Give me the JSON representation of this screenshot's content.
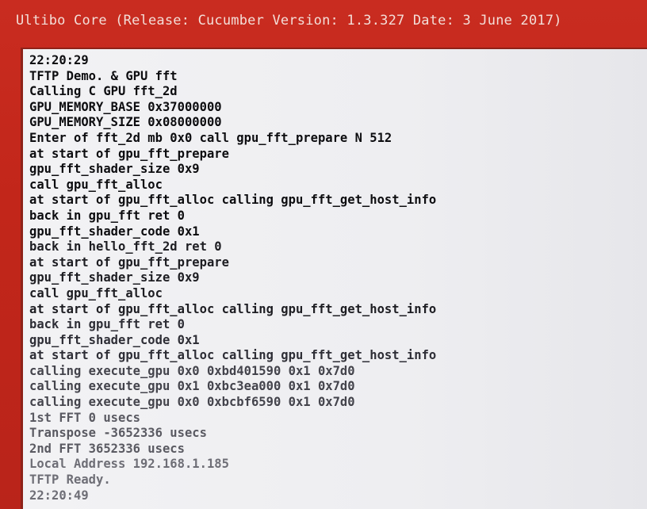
{
  "title_bar": {
    "text": "Ultibo Core (Release: Cucumber Version: 1.3.327 Date: 3 June 2017)"
  },
  "console": {
    "lines": [
      "22:20:29",
      "TFTP Demo. & GPU fft",
      "Calling C GPU fft_2d",
      "GPU_MEMORY_BASE 0x37000000",
      "GPU_MEMORY_SIZE 0x08000000",
      "Enter of fft_2d mb 0x0 call gpu_fft_prepare N 512",
      "at start of gpu_fft_prepare",
      "gpu_fft_shader_size 0x9",
      "call gpu_fft_alloc",
      "at start of gpu_fft_alloc calling gpu_fft_get_host_info",
      "back in gpu_fft ret 0",
      "gpu_fft_shader_code 0x1",
      "back in hello_fft_2d ret 0",
      "at start of gpu_fft_prepare",
      "gpu_fft_shader_size 0x9",
      "call gpu_fft_alloc",
      "at start of gpu_fft_alloc calling gpu_fft_get_host_info",
      "back in gpu_fft ret 0",
      "gpu_fft_shader_code 0x1",
      "at start of gpu_fft_alloc calling gpu_fft_get_host_info",
      "calling execute_gpu 0x0 0xbd401590 0x1 0x7d0",
      "calling execute_gpu 0x1 0xbc3ea000 0x1 0x7d0",
      "calling execute_gpu 0x0 0xbcbf6590 0x1 0x7d0",
      "1st FFT       0 usecs",
      "Transpose -3652336 usecs",
      "2nd FFT   3652336 usecs",
      "Local Address 192.168.1.185",
      "TFTP Ready.",
      "22:20:49"
    ]
  }
}
